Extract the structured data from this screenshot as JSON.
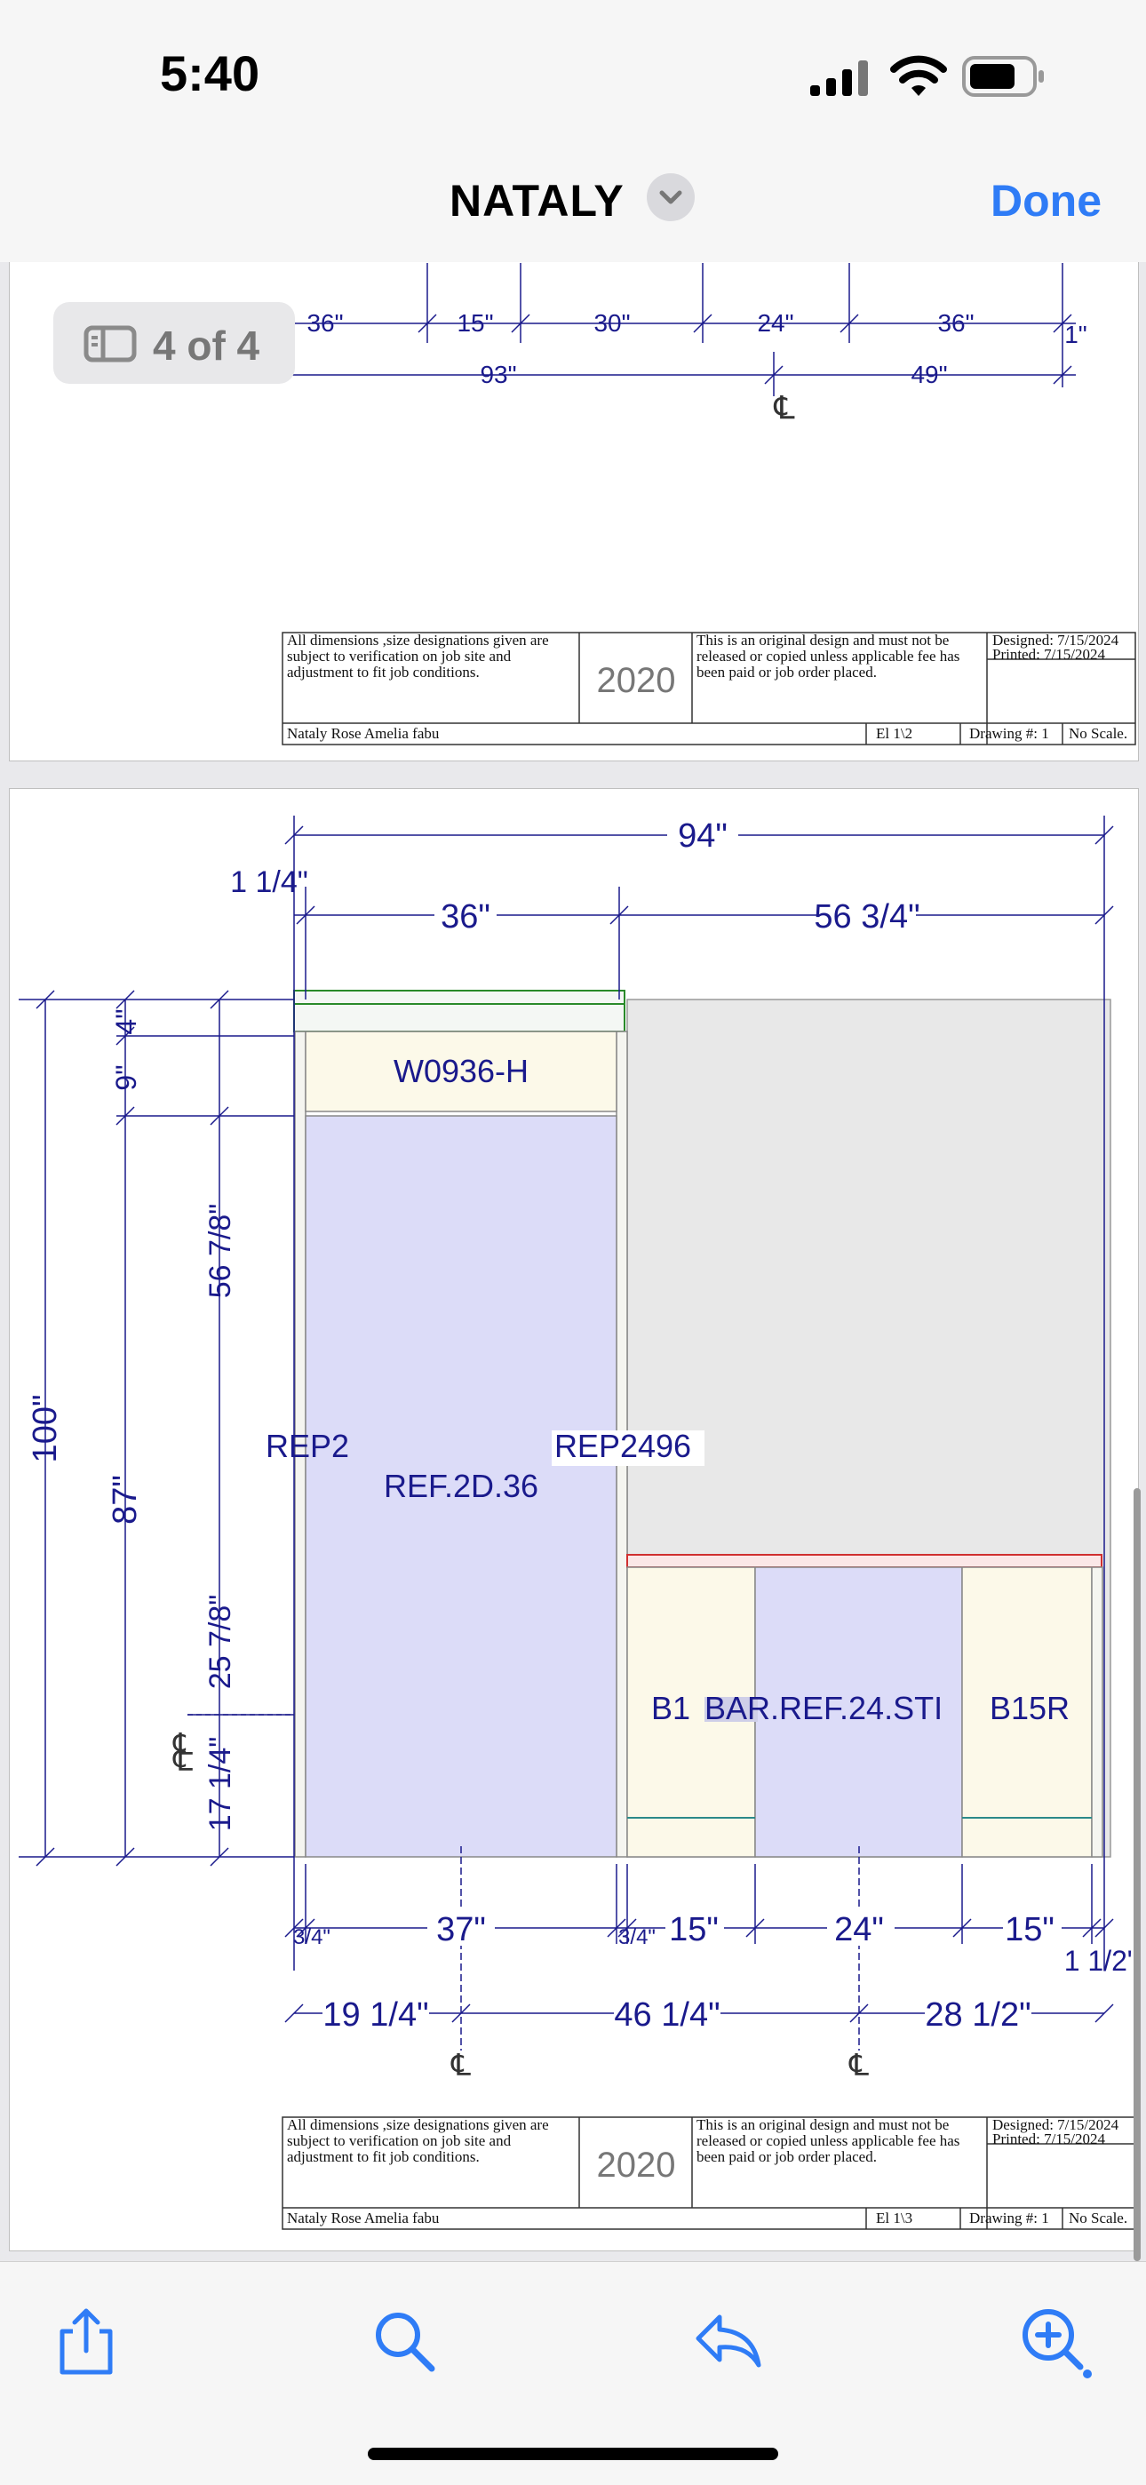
{
  "status_bar": {
    "time": "5:40"
  },
  "nav": {
    "title": "NATALY",
    "done_label": "Done"
  },
  "page_indicator": "4 of 4",
  "page3": {
    "dims_row1": [
      "36\"",
      "15\"",
      "30\"",
      "24\"",
      "36\"",
      "1\""
    ],
    "dims_row2": [
      "93\"",
      "49\""
    ],
    "centerline": "℄"
  },
  "title_block": {
    "disclaimer": "All dimensions ,size designations given are subject to verification on job site and adjustment to fit job conditions.",
    "logo": "2020",
    "copyright": "This is an original design and must not be released or copied unless applicable fee has been paid or job order placed.",
    "designed": "Designed: 7/15/2024",
    "printed": "Printed: 7/15/2024",
    "owner": "Nataly Rose Amelia fabu",
    "drawing_num": "Drawing #: 1",
    "scale": "No Scale."
  },
  "page3_elevation": "El 1\\2",
  "page4_elevation": "El 1\\3",
  "page4": {
    "overall_width": "94\"",
    "top_dims": {
      "left_small": "1 1/4\"",
      "left": "36\"",
      "right": "56 3/4\""
    },
    "left_dims": {
      "overall": "100\"",
      "base": "87\"",
      "top_small": "4\"",
      "top_mid": "9\"",
      "upper": "56 7/8\"",
      "mid": "25 7/8\"",
      "low": "17 1/4\""
    },
    "labels": {
      "wall_cab": "W0936-H",
      "fridge_panel_left": "REP2",
      "fridge_panel_right": "REP2496",
      "fridge": "REF.2D.36",
      "base_left": "B1",
      "bar_fridge": "BAR.REF.24.STI",
      "base_right": "B15R"
    },
    "bottom_dims1": [
      "3/4\"",
      "37\"",
      "3/4\"",
      "15\"",
      "24\"",
      "15\"",
      "1 1/2\""
    ],
    "bottom_dims2": [
      "19 1/4\"",
      "46 1/4\"",
      "28 1/2\""
    ]
  },
  "toolbar": {
    "icons": [
      "share-icon",
      "search-icon",
      "reply-icon",
      "zoom-in-icon"
    ]
  },
  "colors": {
    "accent": "#2f7cf6",
    "dim_line": "#1a1a8c",
    "fridge_fill": "#dcdcf8",
    "cab_fill": "#fcf9e9",
    "wall_fill": "#e8e8e8"
  }
}
